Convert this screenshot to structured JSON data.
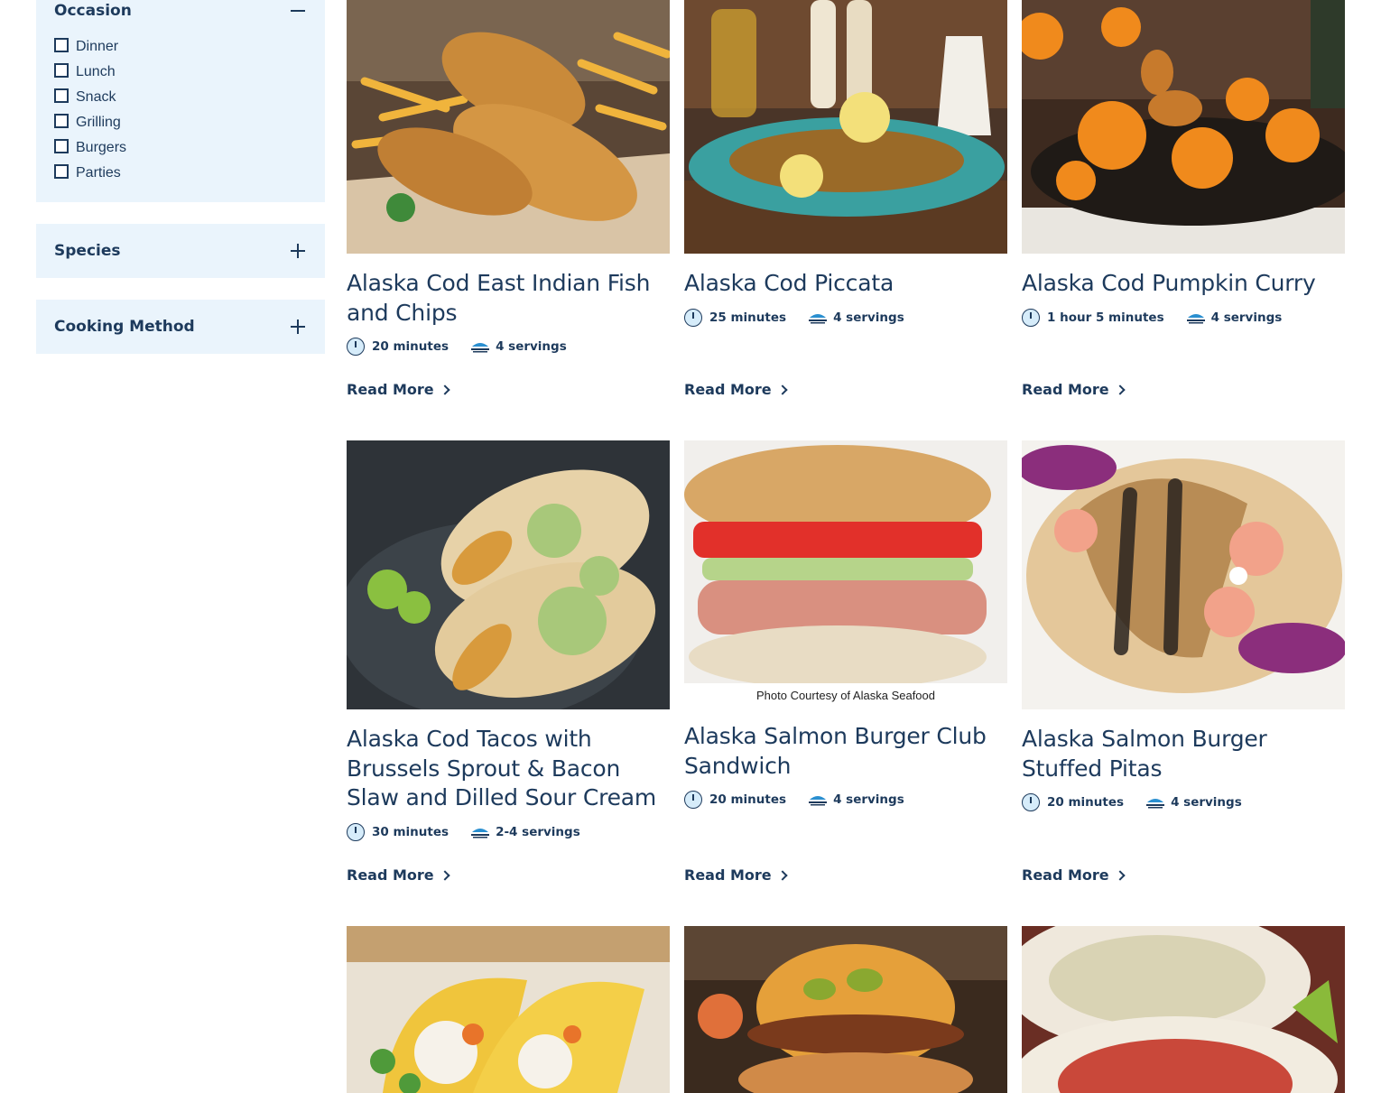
{
  "filters": {
    "occasion": {
      "title": "Occasion",
      "options": [
        "Dinner",
        "Lunch",
        "Snack",
        "Grilling",
        "Burgers",
        "Parties"
      ]
    },
    "species": {
      "title": "Species"
    },
    "cooking_method": {
      "title": "Cooking Method"
    }
  },
  "read_more_label": "Read More",
  "recipes": [
    {
      "title": "Alaska Cod East Indian Fish and Chips",
      "time": "20 minutes",
      "servings": "4 servings"
    },
    {
      "title": "Alaska Cod Piccata",
      "time": "25 minutes",
      "servings": "4 servings"
    },
    {
      "title": "Alaska Cod Pumpkin Curry",
      "time": "1 hour 5 minutes",
      "servings": "4 servings"
    },
    {
      "title": "Alaska Cod Tacos with Brussels Sprout & Bacon Slaw and Dilled Sour Cream",
      "time": "30 minutes",
      "servings": "2-4 servings"
    },
    {
      "title": "Alaska Salmon Burger Club Sandwich",
      "time": "20 minutes",
      "servings": "4 servings",
      "credit": "Photo Courtesy of Alaska Seafood"
    },
    {
      "title": "Alaska Salmon Burger Stuffed Pitas",
      "time": "20 minutes",
      "servings": "4 servings"
    }
  ],
  "colors": {
    "text": "#1d3a5c",
    "panel": "#eaf4fc",
    "icon_accent": "#2a8fd0"
  },
  "icons": {
    "time": "clock-icon",
    "servings": "fish-servings-icon",
    "read_more": "chevron-right-icon"
  }
}
